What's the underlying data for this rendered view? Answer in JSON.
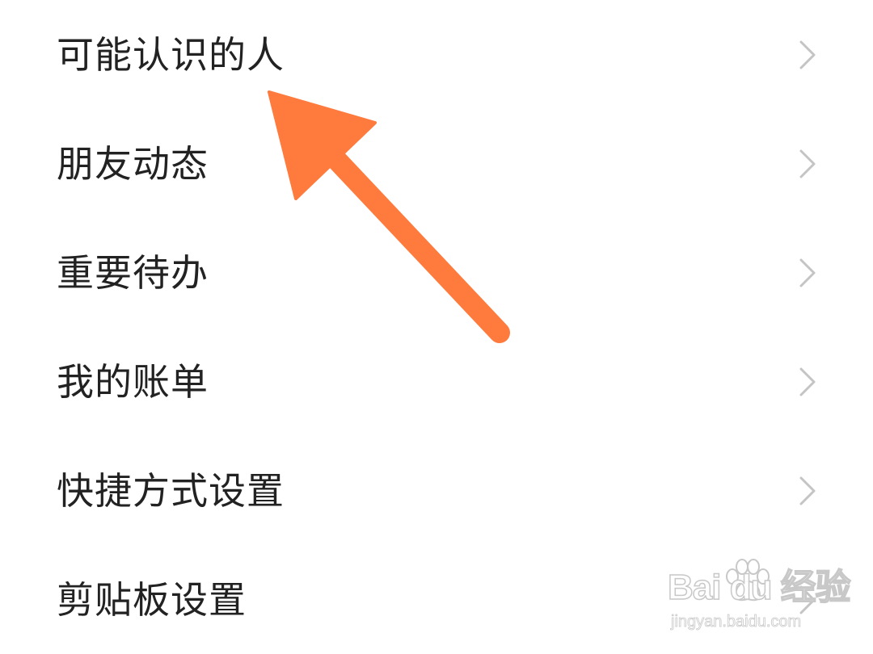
{
  "menu": {
    "items": [
      {
        "label": "可能认识的人",
        "icon": "chevron-right-icon"
      },
      {
        "label": "朋友动态",
        "icon": "chevron-right-icon"
      },
      {
        "label": "重要待办",
        "icon": "chevron-right-icon"
      },
      {
        "label": "我的账单",
        "icon": "chevron-right-icon"
      },
      {
        "label": "快捷方式设置",
        "icon": "chevron-right-icon"
      },
      {
        "label": "剪贴板设置",
        "icon": "chevron-right-icon"
      }
    ]
  },
  "annotation": {
    "arrow_color": "#ff7a3d",
    "icon": "arrow-up-left-icon"
  },
  "watermark": {
    "main": "Bai du 经验",
    "sub": "jingyan.baidu.com"
  },
  "colors": {
    "text": "#222222",
    "chevron": "#c4c4c4",
    "background": "#ffffff"
  }
}
